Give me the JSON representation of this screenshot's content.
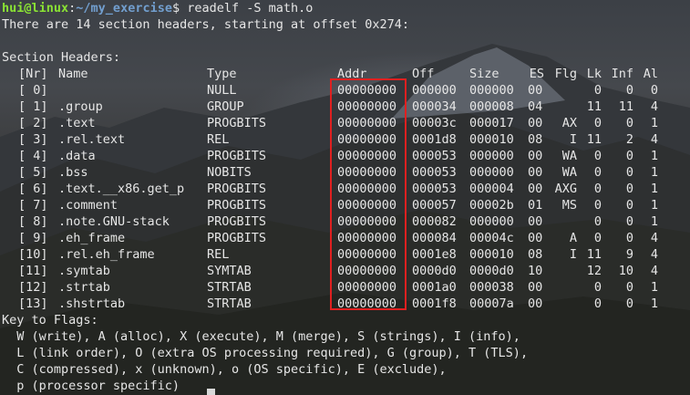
{
  "prompt": {
    "user_host": "hui@linux",
    "sep": ":",
    "path": "~/my_exercise",
    "symbol": "$",
    "command": " readelf -S math.o"
  },
  "summary": "There are 14 section headers, starting at offset 0x274:",
  "blank": "",
  "section_headers_title": "Section Headers:",
  "columns": {
    "nr": "[Nr]",
    "name": "Name",
    "type": "Type",
    "addr": "Addr",
    "off": "Off",
    "size": "Size",
    "es": "ES",
    "flg": "Flg",
    "lk": "Lk",
    "inf": "Inf",
    "al": "Al"
  },
  "sections": [
    {
      "nr": "[ 0]",
      "name": "",
      "type": "NULL",
      "addr": "00000000",
      "off": "000000",
      "size": "000000",
      "es": "00",
      "flg": "",
      "lk": "0",
      "inf": "0",
      "al": "0"
    },
    {
      "nr": "[ 1]",
      "name": ".group",
      "type": "GROUP",
      "addr": "00000000",
      "off": "000034",
      "size": "000008",
      "es": "04",
      "flg": "",
      "lk": "11",
      "inf": "11",
      "al": "4"
    },
    {
      "nr": "[ 2]",
      "name": ".text",
      "type": "PROGBITS",
      "addr": "00000000",
      "off": "00003c",
      "size": "000017",
      "es": "00",
      "flg": "AX",
      "lk": "0",
      "inf": "0",
      "al": "1"
    },
    {
      "nr": "[ 3]",
      "name": ".rel.text",
      "type": "REL",
      "addr": "00000000",
      "off": "0001d8",
      "size": "000010",
      "es": "08",
      "flg": "I",
      "lk": "11",
      "inf": "2",
      "al": "4"
    },
    {
      "nr": "[ 4]",
      "name": ".data",
      "type": "PROGBITS",
      "addr": "00000000",
      "off": "000053",
      "size": "000000",
      "es": "00",
      "flg": "WA",
      "lk": "0",
      "inf": "0",
      "al": "1"
    },
    {
      "nr": "[ 5]",
      "name": ".bss",
      "type": "NOBITS",
      "addr": "00000000",
      "off": "000053",
      "size": "000000",
      "es": "00",
      "flg": "WA",
      "lk": "0",
      "inf": "0",
      "al": "1"
    },
    {
      "nr": "[ 6]",
      "name": ".text.__x86.get_p",
      "type": "PROGBITS",
      "addr": "00000000",
      "off": "000053",
      "size": "000004",
      "es": "00",
      "flg": "AXG",
      "lk": "0",
      "inf": "0",
      "al": "1"
    },
    {
      "nr": "[ 7]",
      "name": ".comment",
      "type": "PROGBITS",
      "addr": "00000000",
      "off": "000057",
      "size": "00002b",
      "es": "01",
      "flg": "MS",
      "lk": "0",
      "inf": "0",
      "al": "1"
    },
    {
      "nr": "[ 8]",
      "name": ".note.GNU-stack",
      "type": "PROGBITS",
      "addr": "00000000",
      "off": "000082",
      "size": "000000",
      "es": "00",
      "flg": "",
      "lk": "0",
      "inf": "0",
      "al": "1"
    },
    {
      "nr": "[ 9]",
      "name": ".eh_frame",
      "type": "PROGBITS",
      "addr": "00000000",
      "off": "000084",
      "size": "00004c",
      "es": "00",
      "flg": "A",
      "lk": "0",
      "inf": "0",
      "al": "4"
    },
    {
      "nr": "[10]",
      "name": ".rel.eh_frame",
      "type": "REL",
      "addr": "00000000",
      "off": "0001e8",
      "size": "000010",
      "es": "08",
      "flg": "I",
      "lk": "11",
      "inf": "9",
      "al": "4"
    },
    {
      "nr": "[11]",
      "name": ".symtab",
      "type": "SYMTAB",
      "addr": "00000000",
      "off": "0000d0",
      "size": "0000d0",
      "es": "10",
      "flg": "",
      "lk": "12",
      "inf": "10",
      "al": "4"
    },
    {
      "nr": "[12]",
      "name": ".strtab",
      "type": "STRTAB",
      "addr": "00000000",
      "off": "0001a0",
      "size": "000038",
      "es": "00",
      "flg": "",
      "lk": "0",
      "inf": "0",
      "al": "1"
    },
    {
      "nr": "[13]",
      "name": ".shstrtab",
      "type": "STRTAB",
      "addr": "00000000",
      "off": "0001f8",
      "size": "00007a",
      "es": "00",
      "flg": "",
      "lk": "0",
      "inf": "0",
      "al": "1"
    }
  ],
  "key_to_flags": {
    "title": "Key to Flags:",
    "lines": [
      "  W (write), A (alloc), X (execute), M (merge), S (strings), I (info),",
      "  L (link order), O (extra OS processing required), G (group), T (TLS),",
      "  C (compressed), x (unknown), o (OS specific), E (exclude),",
      "  p (processor specific)"
    ]
  },
  "colors": {
    "user_host": "#8ae234",
    "path": "#729fcf",
    "text": "#e6e6e6",
    "highlight_box": "#e02020"
  }
}
